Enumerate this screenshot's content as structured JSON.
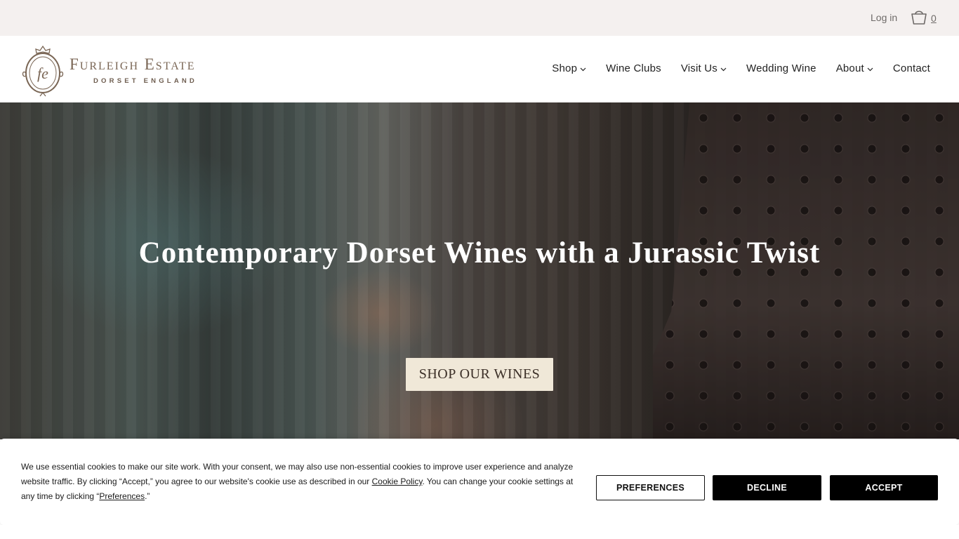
{
  "topbar": {
    "login_label": "Log in",
    "cart_count": "0",
    "cart_icon": "basket-icon"
  },
  "brand": {
    "emblem_letters": "fe",
    "name": "Furleigh Estate",
    "tagline": "DORSET ENGLAND",
    "color": "#7a6655"
  },
  "nav": {
    "items": [
      {
        "label": "Shop",
        "has_dropdown": true
      },
      {
        "label": "Wine Clubs",
        "has_dropdown": false
      },
      {
        "label": "Visit Us",
        "has_dropdown": true
      },
      {
        "label": "Wedding Wine",
        "has_dropdown": false
      },
      {
        "label": "About",
        "has_dropdown": true
      },
      {
        "label": "Contact",
        "has_dropdown": false
      }
    ]
  },
  "hero": {
    "title": "Contemporary Dorset Wines with a Jurassic Twist",
    "cta_label": "SHOP OUR WINES",
    "cta_color": "#f0e8d8"
  },
  "cookie": {
    "text_1": "We use essential cookies to make our site work. With your consent, we may also use non-essential cookies to improve user experience and analyze website traffic. By clicking “Accept,” you agree to our website's cookie use as described in our ",
    "policy_link": "Cookie Policy",
    "text_2": ". You can change your cookie settings at any time by clicking “",
    "preferences_link": "Preferences",
    "text_3": ".”",
    "preferences_label": "PREFERENCES",
    "decline_label": "DECLINE",
    "accept_label": "ACCEPT"
  }
}
